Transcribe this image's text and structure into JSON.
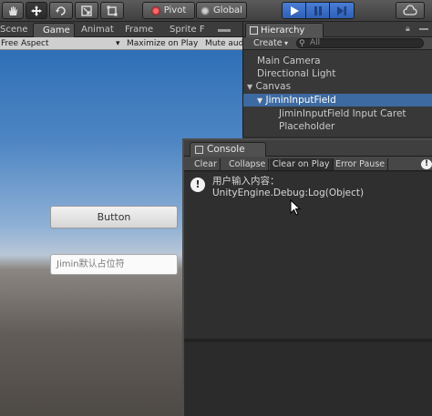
{
  "toolbar": {
    "pivot_label": "Pivot",
    "global_label": "Global"
  },
  "game": {
    "tabs": [
      "Scene",
      "Game",
      "Animat",
      "Frame",
      "Sprite F"
    ],
    "aspect": "Free Aspect",
    "maximize": "Maximize on Play",
    "mute": "Mute aud",
    "ui_button_label": "Button",
    "input_placeholder": "Jimin默认占位符"
  },
  "hierarchy": {
    "tab_label": "Hierarchy",
    "create_label": "Create",
    "search_placeholder": "All",
    "items": [
      "Main Camera",
      "Directional Light",
      "Canvas",
      "JiminInputField",
      "JiminInputField Input Caret",
      "Placeholder"
    ]
  },
  "console": {
    "tab_label": "Console",
    "buttons": [
      "Clear",
      "Collapse",
      "Clear on Play",
      "Error Pause"
    ],
    "log_line1": "用户输入内容：",
    "log_line2": "UnityEngine.Debug:Log(Object)"
  },
  "colors": {
    "play_active": "#3a6fc6",
    "selection": "#3d6aa0"
  }
}
